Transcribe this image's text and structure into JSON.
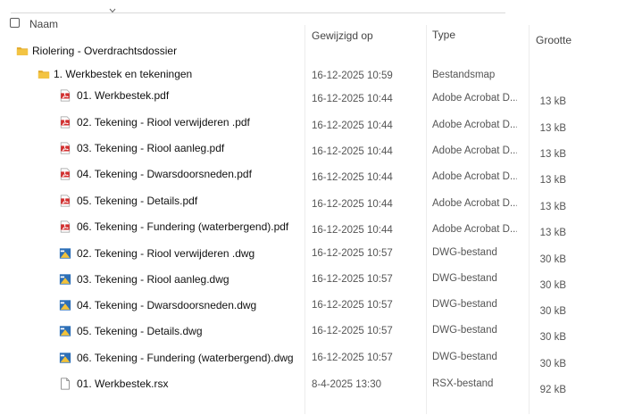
{
  "header": {
    "name": "Naam",
    "modified": "Gewijzigd op",
    "type": "Type",
    "size": "Grootte"
  },
  "colors": {
    "folder": "#f3c443",
    "folder_dark": "#e2a92b",
    "pdf_red": "#d32f2f",
    "dwg_blue": "#2d6fb7",
    "dwg_yellow": "#f2c23a"
  },
  "rows": [
    {
      "name": "Riolering - Overdrachtsdossier",
      "icon": "folder-icon",
      "modified": "",
      "type": "",
      "size": ""
    },
    {
      "name": "1. Werkbestek en tekeningen",
      "icon": "folder-icon",
      "modified": "16-12-2025 10:59",
      "type": "Bestandsmap",
      "size": ""
    },
    {
      "name": "01. Werkbestek.pdf",
      "icon": "pdf-icon",
      "modified": "16-12-2025 10:44",
      "type": "Adobe Acrobat D...",
      "size": "13 kB"
    },
    {
      "name": "02. Tekening - Riool verwijderen .pdf",
      "icon": "pdf-icon",
      "modified": "16-12-2025 10:44",
      "type": "Adobe Acrobat D...",
      "size": "13 kB"
    },
    {
      "name": "03. Tekening - Riool aanleg.pdf",
      "icon": "pdf-icon",
      "modified": "16-12-2025 10:44",
      "type": "Adobe Acrobat D...",
      "size": "13 kB"
    },
    {
      "name": "04. Tekening - Dwarsdoorsneden.pdf",
      "icon": "pdf-icon",
      "modified": "16-12-2025 10:44",
      "type": "Adobe Acrobat D...",
      "size": "13 kB"
    },
    {
      "name": "05. Tekening - Details.pdf",
      "icon": "pdf-icon",
      "modified": "16-12-2025 10:44",
      "type": "Adobe Acrobat D...",
      "size": "13 kB"
    },
    {
      "name": "06. Tekening - Fundering (waterbergend).pdf",
      "icon": "pdf-icon",
      "modified": "16-12-2025 10:44",
      "type": "Adobe Acrobat D...",
      "size": "13 kB"
    },
    {
      "name": "02. Tekening - Riool verwijderen .dwg",
      "icon": "dwg-icon",
      "modified": "16-12-2025 10:57",
      "type": "DWG-bestand",
      "size": "30 kB"
    },
    {
      "name": "03. Tekening - Riool aanleg.dwg",
      "icon": "dwg-icon",
      "modified": "16-12-2025 10:57",
      "type": "DWG-bestand",
      "size": "30 kB"
    },
    {
      "name": "04. Tekening - Dwarsdoorsneden.dwg",
      "icon": "dwg-icon",
      "modified": "16-12-2025 10:57",
      "type": "DWG-bestand",
      "size": "30 kB"
    },
    {
      "name": "05. Tekening - Details.dwg",
      "icon": "dwg-icon",
      "modified": "16-12-2025 10:57",
      "type": "DWG-bestand",
      "size": "30 kB"
    },
    {
      "name": "06. Tekening - Fundering (waterbergend).dwg",
      "icon": "dwg-icon",
      "modified": "16-12-2025 10:57",
      "type": "DWG-bestand",
      "size": "30 kB"
    },
    {
      "name": "01. Werkbestek.rsx",
      "icon": "file-icon",
      "modified": "8-4-2025 13:30",
      "type": "RSX-bestand",
      "size": "92 kB"
    }
  ]
}
